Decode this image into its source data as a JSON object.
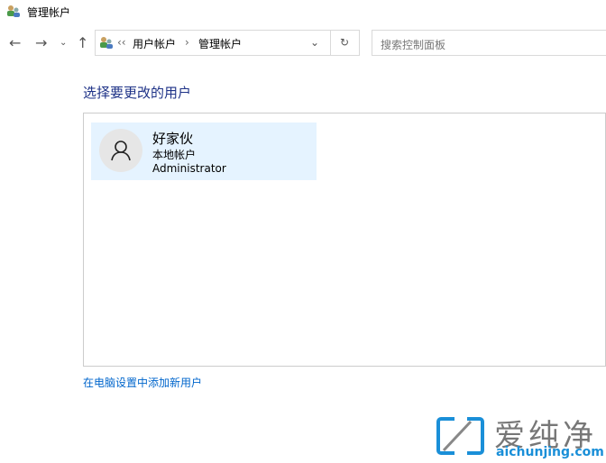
{
  "window": {
    "title": "管理帐户"
  },
  "address": {
    "breadcrumbs": [
      "用户帐户",
      "管理帐户"
    ],
    "overflow": "‹‹"
  },
  "search": {
    "placeholder": "搜索控制面板"
  },
  "main": {
    "heading": "选择要更改的用户",
    "link": "在电脑设置中添加新用户"
  },
  "user": {
    "name": "好家伙",
    "type": "本地帐户",
    "role": "Administrator"
  },
  "watermark": {
    "text": "爱纯净",
    "url": "aichunjing.com"
  }
}
